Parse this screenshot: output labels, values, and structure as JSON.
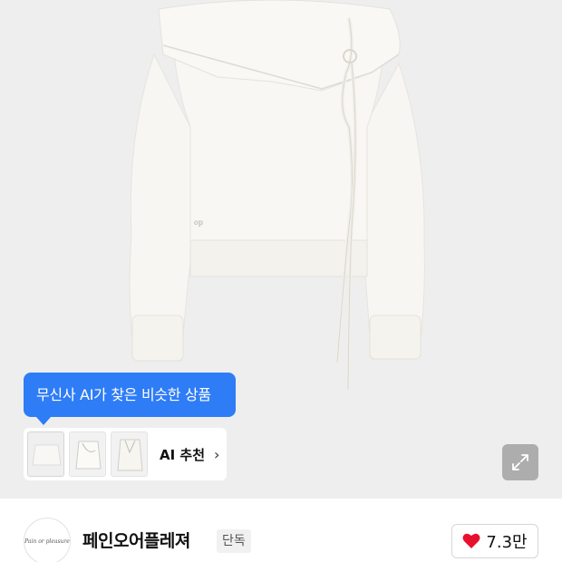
{
  "ai_tooltip": {
    "text": "무신사 AI가 찾은 비슷한 상품"
  },
  "ai_recommend": {
    "label": "AI 추천",
    "chevron": "›"
  },
  "icons": {
    "expand": "expand-icon",
    "heart": "heart-icon",
    "chevron": "chevron-right-icon"
  },
  "brand": {
    "name": "페인오어플레져",
    "badge": "단독",
    "logo_text": "Pain or pleasure"
  },
  "likes": {
    "count": "7.3만"
  },
  "colors": {
    "accent": "#2e7cf6",
    "heart": "#e8112d",
    "background": "#eeeeee"
  }
}
